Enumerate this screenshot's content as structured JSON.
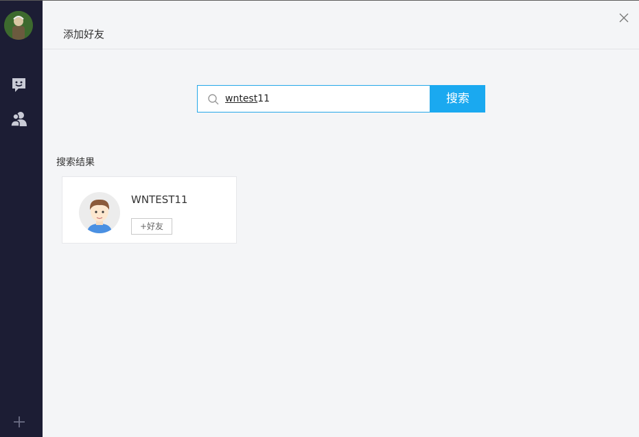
{
  "header": {
    "title": "添加好友"
  },
  "search": {
    "value_underlined": "wntest",
    "value_rest": "11",
    "button_label": "搜索"
  },
  "results": {
    "label": "搜索结果",
    "items": [
      {
        "name": "WNTEST11",
        "add_button_label": "+好友"
      }
    ]
  },
  "colors": {
    "sidebar_bg": "#1c1d34",
    "accent": "#1aa9f0",
    "page_bg": "#f4f5f7"
  },
  "icons": {
    "sidebar": [
      "chat-icon",
      "contacts-icon",
      "add-icon"
    ],
    "header": [
      "close-icon"
    ],
    "search": [
      "search-icon"
    ]
  }
}
